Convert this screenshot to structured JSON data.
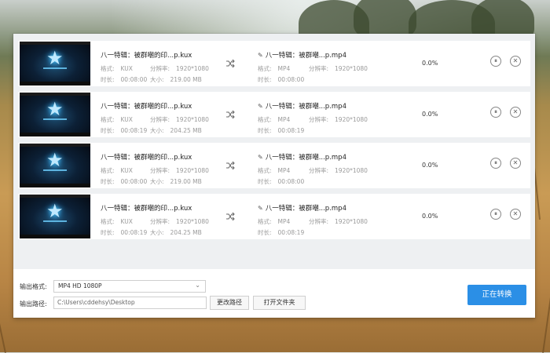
{
  "items": [
    {
      "source": {
        "name": "八一特辑：被群嘲的印...p.kux",
        "format_label": "格式:",
        "format": "KUX",
        "res_label": "分辨率:",
        "res": "1920*1080",
        "dur_label": "时长:",
        "dur": "00:08:00",
        "size_label": "大小:",
        "size": "219.00 MB"
      },
      "output": {
        "name": "八一特辑：被群嘲...p.mp4",
        "format_label": "格式:",
        "format": "MP4",
        "res_label": "分辨率:",
        "res": "1920*1080",
        "dur_label": "时长:",
        "dur": "00:08:00"
      },
      "progress": "0.0%"
    },
    {
      "source": {
        "name": "八一特辑：被群嘲的印...p.kux",
        "format_label": "格式:",
        "format": "KUX",
        "res_label": "分辨率:",
        "res": "1920*1080",
        "dur_label": "时长:",
        "dur": "00:08:19",
        "size_label": "大小:",
        "size": "204.25 MB"
      },
      "output": {
        "name": "八一特辑：被群嘲...p.mp4",
        "format_label": "格式:",
        "format": "MP4",
        "res_label": "分辨率:",
        "res": "1920*1080",
        "dur_label": "时长:",
        "dur": "00:08:19"
      },
      "progress": "0.0%"
    },
    {
      "source": {
        "name": "八一特辑：被群嘲的印...p.kux",
        "format_label": "格式:",
        "format": "KUX",
        "res_label": "分辨率:",
        "res": "1920*1080",
        "dur_label": "时长:",
        "dur": "00:08:00",
        "size_label": "大小:",
        "size": "219.00 MB"
      },
      "output": {
        "name": "八一特辑：被群嘲...p.mp4",
        "format_label": "格式:",
        "format": "MP4",
        "res_label": "分辨率:",
        "res": "1920*1080",
        "dur_label": "时长:",
        "dur": "00:08:00"
      },
      "progress": "0.0%"
    },
    {
      "source": {
        "name": "八一特辑：被群嘲的印...p.kux",
        "format_label": "格式:",
        "format": "KUX",
        "res_label": "分辨率:",
        "res": "1920*1080",
        "dur_label": "时长:",
        "dur": "00:08:19",
        "size_label": "大小:",
        "size": "204.25 MB"
      },
      "output": {
        "name": "八一特辑：被群嘲...p.mp4",
        "format_label": "格式:",
        "format": "MP4",
        "res_label": "分辨率:",
        "res": "1920*1080",
        "dur_label": "时长:",
        "dur": "00:08:19"
      },
      "progress": "0.0%"
    }
  ],
  "controls": {
    "pause_glyph": "⏸",
    "remove_glyph": "✕",
    "pencil_glyph": "✎",
    "chevron_glyph": "⌄"
  },
  "bottom": {
    "format_label": "输出格式:",
    "format_value": "MP4  HD 1080P",
    "path_label": "输出路径:",
    "path_value": "C:\\Users\\cddehsy\\Desktop",
    "change_path_button": "更改路径",
    "open_folder_button": "打开文件夹",
    "convert_button": "正在转换"
  },
  "colors": {
    "accent": "#2b8fe6",
    "row_bg": "#ffffff",
    "window_bg": "#eef0f2"
  }
}
